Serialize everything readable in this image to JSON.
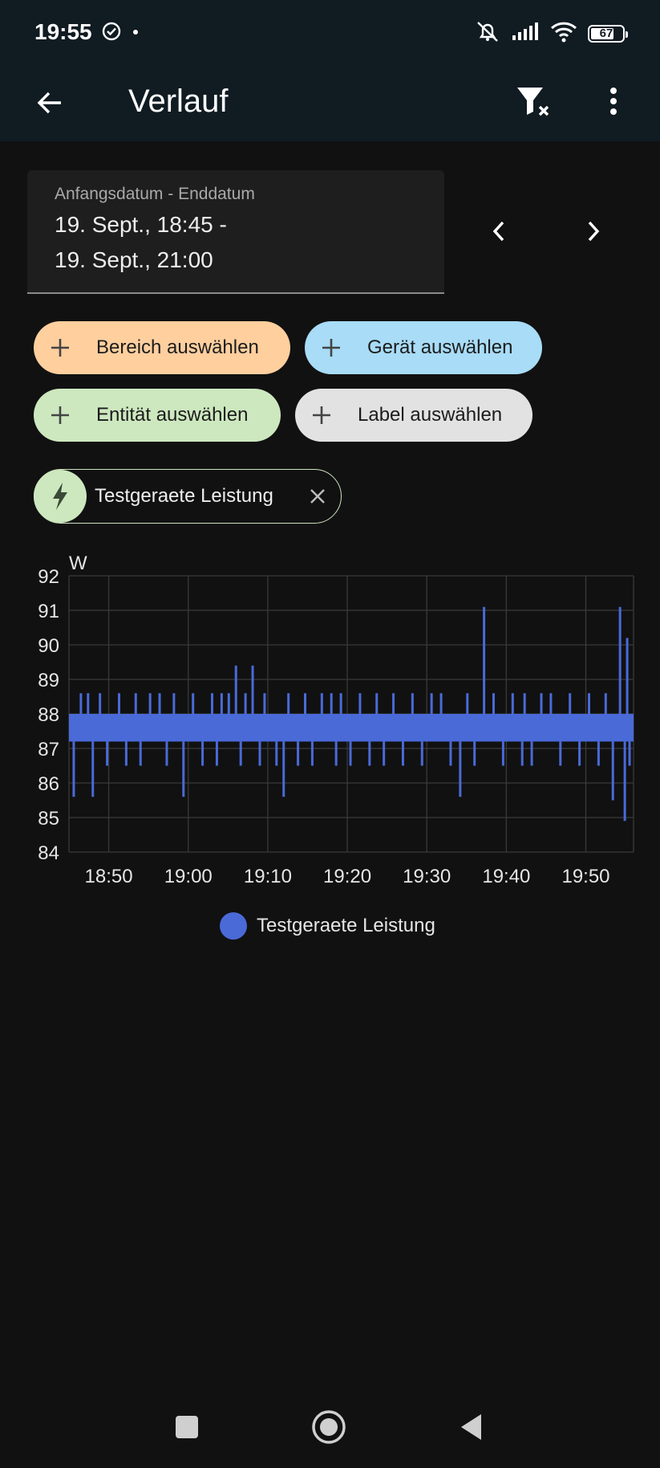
{
  "status_bar": {
    "time": "19:55",
    "battery": "67"
  },
  "app_bar": {
    "title": "Verlauf"
  },
  "date_range": {
    "label": "Anfangsdatum - Enddatum",
    "line1": "19. Sept., 18:45 -",
    "line2": "19. Sept., 21:00"
  },
  "filters": {
    "area": "Bereich auswählen",
    "device": "Gerät auswählen",
    "entity": "Entität auswählen",
    "label": "Label auswählen"
  },
  "selected_entity": {
    "name": "Testgeraete Leistung"
  },
  "colors": {
    "series": "#4a6ad8",
    "grid": "#3a3a3a"
  },
  "chart_data": {
    "type": "line",
    "ylabel": "W",
    "ylim": [
      84,
      92
    ],
    "yticks": [
      "92",
      "91",
      "90",
      "89",
      "88",
      "87",
      "86",
      "85",
      "84"
    ],
    "xrange_minutes": [
      18.75,
      19.9333
    ],
    "xticks": [
      {
        "label": "18:50",
        "x": 18.8333
      },
      {
        "label": "19:00",
        "x": 19.0
      },
      {
        "label": "19:10",
        "x": 19.1667
      },
      {
        "label": "19:20",
        "x": 19.3333
      },
      {
        "label": "19:30",
        "x": 19.5
      },
      {
        "label": "19:40",
        "x": 19.6667
      },
      {
        "label": "19:50",
        "x": 19.8333
      }
    ],
    "band": [
      87.2,
      88.0
    ],
    "series": [
      {
        "name": "Testgeraete Leistung",
        "spikes_time": [
          18.76,
          18.775,
          18.79,
          18.8,
          18.815,
          18.83,
          18.855,
          18.87,
          18.89,
          18.9,
          18.92,
          18.94,
          18.955,
          18.97,
          18.99,
          19.01,
          19.03,
          19.05,
          19.06,
          19.07,
          19.085,
          19.1,
          19.11,
          19.12,
          19.135,
          19.15,
          19.16,
          19.185,
          19.2,
          19.21,
          19.23,
          19.245,
          19.26,
          19.28,
          19.3,
          19.31,
          19.32,
          19.34,
          19.36,
          19.38,
          19.395,
          19.41,
          19.43,
          19.45,
          19.47,
          19.49,
          19.51,
          19.53,
          19.55,
          19.57,
          19.585,
          19.6,
          19.62,
          19.64,
          19.66,
          19.68,
          19.7,
          19.705,
          19.72,
          19.74,
          19.76,
          19.78,
          19.8,
          19.82,
          19.84,
          19.86,
          19.875,
          19.89,
          19.905,
          19.915,
          19.92,
          19.925
        ],
        "spikes_value": [
          85.6,
          88.6,
          88.6,
          85.6,
          88.6,
          86.5,
          88.6,
          86.5,
          88.6,
          86.5,
          88.6,
          88.6,
          86.5,
          88.6,
          85.6,
          88.6,
          86.5,
          88.6,
          86.5,
          88.6,
          88.6,
          89.4,
          86.5,
          88.6,
          89.4,
          86.5,
          88.6,
          86.5,
          85.6,
          88.6,
          86.5,
          88.6,
          86.5,
          88.6,
          88.6,
          86.5,
          88.6,
          86.5,
          88.6,
          86.5,
          88.6,
          86.5,
          88.6,
          86.5,
          88.6,
          86.5,
          88.6,
          88.6,
          86.5,
          85.6,
          88.6,
          86.5,
          91.1,
          88.6,
          86.5,
          88.6,
          86.5,
          88.6,
          86.5,
          88.6,
          88.6,
          86.5,
          88.6,
          86.5,
          88.6,
          86.5,
          88.6,
          85.5,
          91.1,
          84.9,
          90.2,
          86.5
        ]
      }
    ],
    "legend": [
      "Testgeraete Leistung"
    ]
  },
  "nav": {
    "recents": "recents",
    "home": "home",
    "back": "back"
  }
}
